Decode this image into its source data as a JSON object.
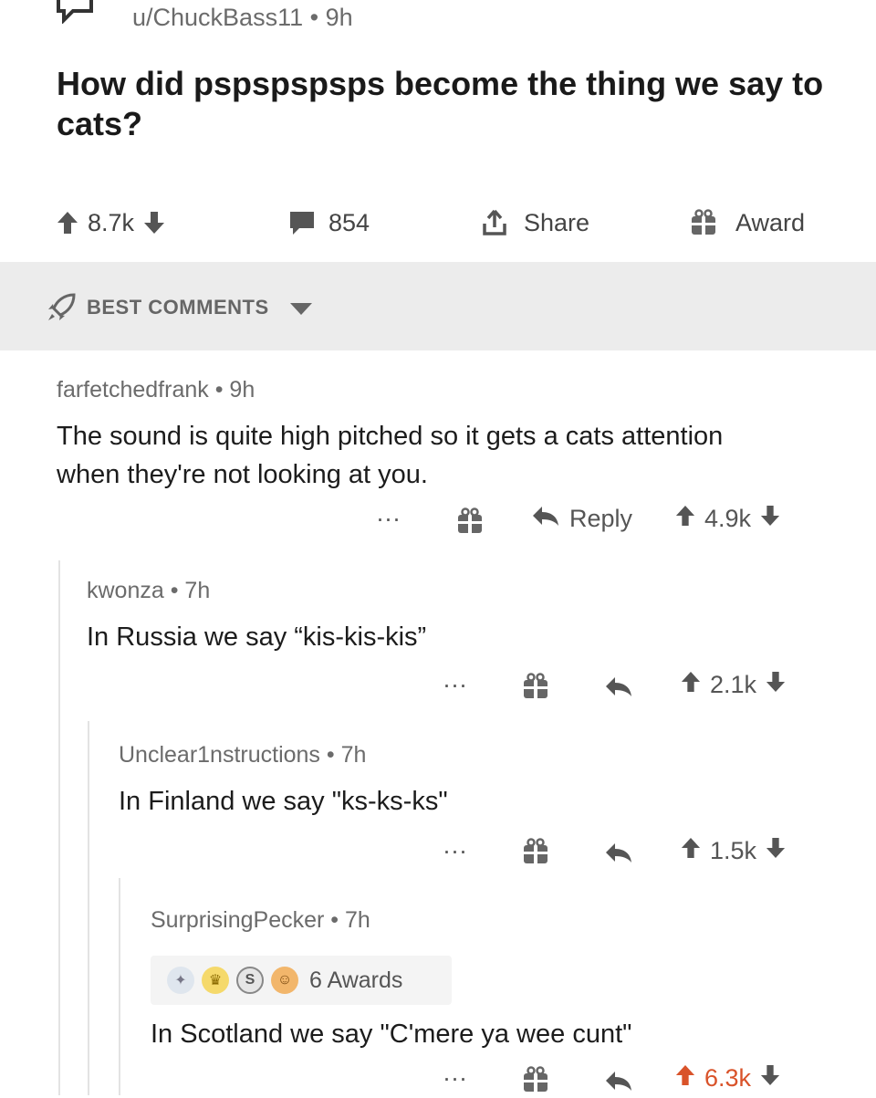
{
  "post": {
    "author": "u/ChuckBass11",
    "age": "9h",
    "title": "How did pspspspsps become the thing we say to cats?",
    "score": "8.7k",
    "comments": "854",
    "share_label": "Share",
    "award_label": "Award"
  },
  "sort": {
    "label": "BEST COMMENTS"
  },
  "comments": [
    {
      "author": "farfetchedfrank",
      "age": "9h",
      "body": "The sound is quite high pitched so it gets a cats attention when they're not looking at you.",
      "reply_label": "Reply",
      "score": "4.9k"
    },
    {
      "author": "kwonza",
      "age": "7h",
      "body": "In Russia we say “kis-kis-kis”",
      "score": "2.1k"
    },
    {
      "author": "Unclear1nstructions",
      "age": "7h",
      "body": "In Finland we say \"ks-ks-ks\"",
      "score": "1.5k"
    },
    {
      "author": "SurprisingPecker",
      "age": "7h",
      "awards_label": "6 Awards",
      "body": "In Scotland we say \"C'mere ya wee cunt\"",
      "score": "6.3k"
    }
  ],
  "icons": {
    "more": "more-dots-icon",
    "gift": "gift-icon",
    "reply": "reply-arrow-icon",
    "upvote": "upvote-arrow-icon",
    "downvote": "downvote-arrow-icon"
  },
  "colors": {
    "upvoted": "#d9532a",
    "sortbar": "#ececec",
    "text": "#1c1c1c",
    "meta": "#6b6b6b"
  }
}
